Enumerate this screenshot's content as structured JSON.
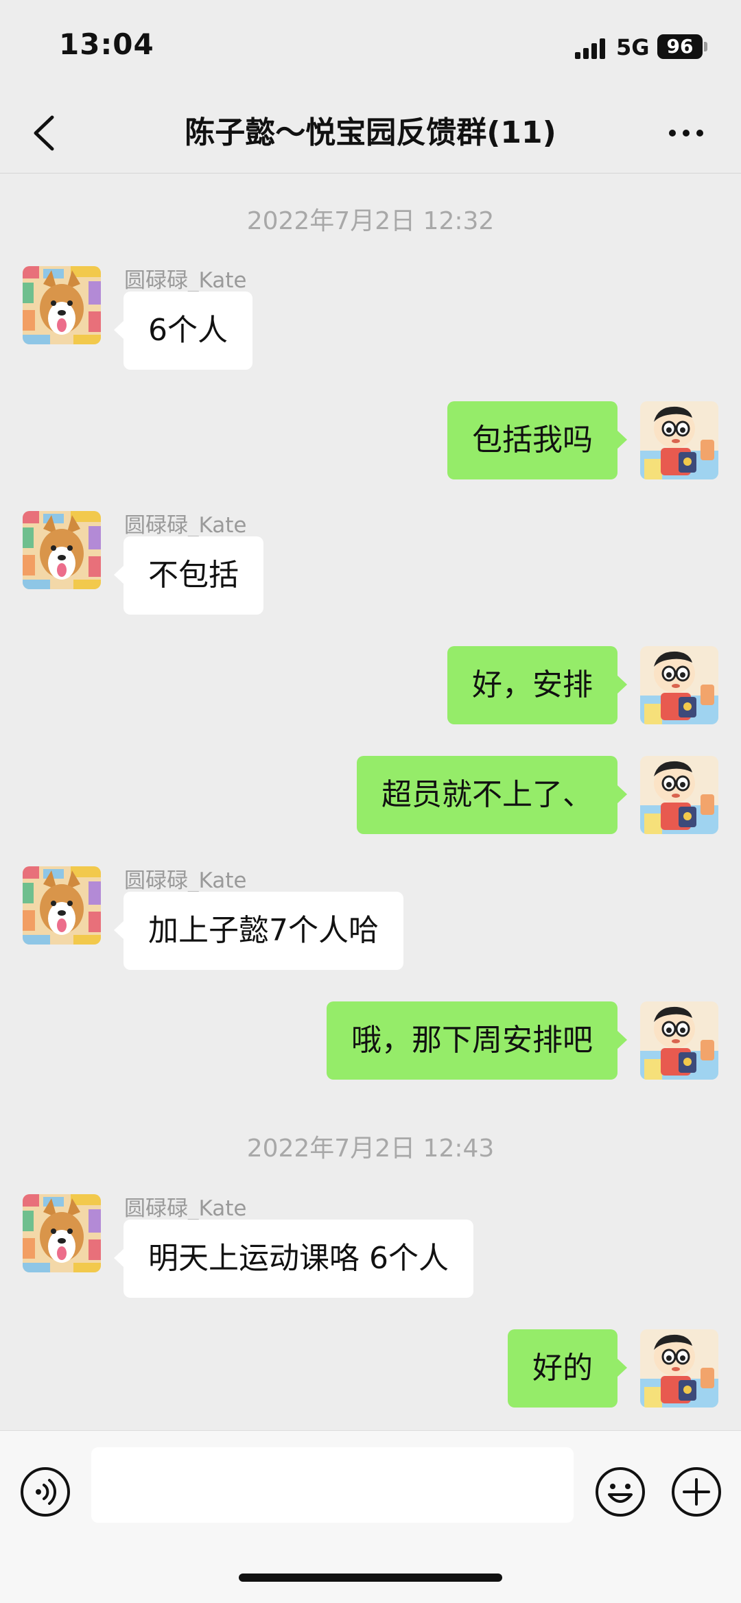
{
  "status_bar": {
    "time": "13:04",
    "network": "5G",
    "battery": "96",
    "signal_icon": "signal-bars-icon"
  },
  "nav": {
    "back_icon": "chevron-left-icon",
    "title": "陈子懿～悦宝园反馈群(11)",
    "more_icon": "more-horizontal-icon"
  },
  "messages": {
    "timestamps": [
      "2022年7月2日 12:32",
      "2022年7月2日 12:43"
    ],
    "sender_name": "圆碌碌_Kate",
    "items": [
      {
        "direction": "in",
        "text": "6个人"
      },
      {
        "direction": "out",
        "text": "包括我吗"
      },
      {
        "direction": "in",
        "text": "不包括"
      },
      {
        "direction": "out",
        "text": "好，安排"
      },
      {
        "direction": "out",
        "text": "超员就不上了、"
      },
      {
        "direction": "in",
        "text": "加上子懿7个人哈"
      },
      {
        "direction": "out",
        "text": "哦，那下周安排吧"
      },
      {
        "direction": "in",
        "text": "明天上运动课咯 6个人"
      },
      {
        "direction": "out",
        "text": "好的"
      }
    ]
  },
  "input_bar": {
    "voice_icon": "voice-icon",
    "input_value": "",
    "emoji_icon": "emoji-icon",
    "plus_icon": "plus-circle-icon"
  },
  "colors": {
    "background": "#ededed",
    "incoming_bubble": "#ffffff",
    "outgoing_bubble": "#95ec69",
    "timestamp_text": "#a8a8a8",
    "sender_text": "#9a9a9a"
  }
}
